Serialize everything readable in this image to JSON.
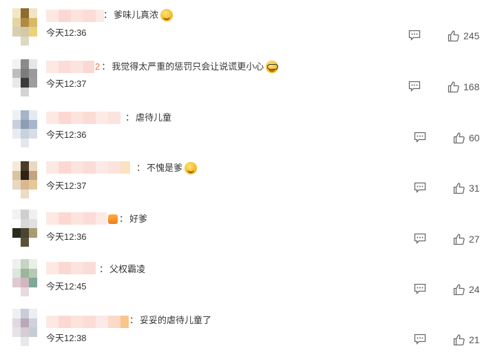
{
  "comments": [
    {
      "reply_prefix": "",
      "colon": "：",
      "text": "爹味儿真浓",
      "emoji": "sweat-smile-emoji",
      "time": "今天12:36",
      "likes": "245"
    },
    {
      "reply_prefix": "2",
      "colon": "：",
      "text": "我觉得太严重的惩罚只会让说谎更小心",
      "emoji": "glasses-emoji",
      "time": "今天12:37",
      "likes": "168"
    },
    {
      "reply_prefix": "",
      "colon": "：",
      "text": "虐待儿童",
      "emoji": "",
      "time": "今天12:36",
      "likes": "60"
    },
    {
      "reply_prefix": "",
      "colon": "：",
      "text": "不愧是爹",
      "emoji": "scream-emoji",
      "time": "今天12:37",
      "likes": "31"
    },
    {
      "reply_prefix": "",
      "colon": "：",
      "text": "好爹",
      "emoji": "",
      "time": "今天12:36",
      "likes": "27"
    },
    {
      "reply_prefix": "",
      "colon": "：",
      "text": "父权霸凌",
      "emoji": "",
      "time": "今天12:45",
      "likes": "24"
    },
    {
      "reply_prefix": "",
      "colon": "：",
      "text": "妥妥的虐待儿童了",
      "emoji": "",
      "time": "今天12:38",
      "likes": "21"
    }
  ],
  "icons": {
    "reply": "comment-bubble-icon",
    "like": "thumbs-up-icon"
  },
  "colors": {
    "reply_prefix": "#eb7350",
    "text": "#333333",
    "icon": "#666666"
  }
}
